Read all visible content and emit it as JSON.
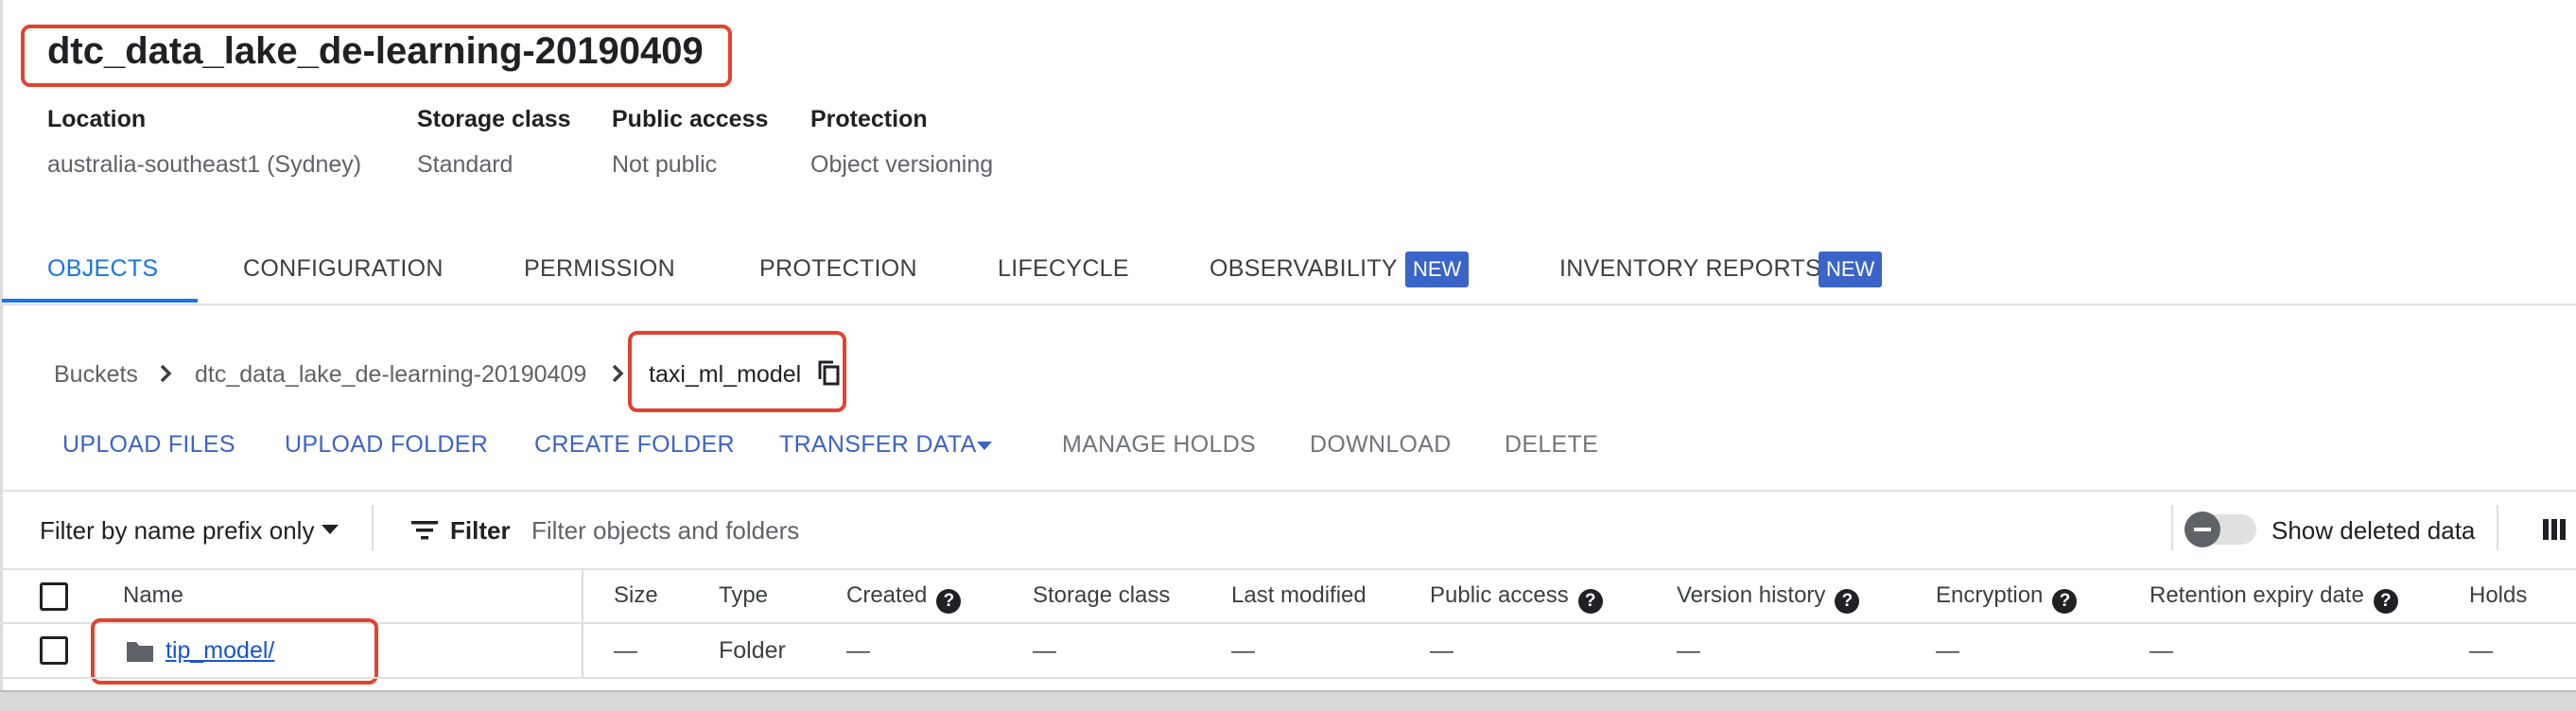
{
  "bucket": {
    "name": "dtc_data_lake_de-learning-20190409",
    "location_label": "Location",
    "location_value": "australia-southeast1 (Sydney)",
    "storage_class_label": "Storage class",
    "storage_class_value": "Standard",
    "public_access_label": "Public access",
    "public_access_value": "Not public",
    "protection_label": "Protection",
    "protection_value": "Object versioning"
  },
  "tabs": [
    {
      "label": "OBJECTS",
      "active": true
    },
    {
      "label": "CONFIGURATION"
    },
    {
      "label": "PERMISSION"
    },
    {
      "label": "PROTECTION"
    },
    {
      "label": "LIFECYCLE"
    },
    {
      "label": "OBSERVABILITY",
      "badge": "NEW"
    },
    {
      "label": "INVENTORY REPORTS",
      "badge": "NEW"
    }
  ],
  "breadcrumb": {
    "root": "Buckets",
    "bucket": "dtc_data_lake_de-learning-20190409",
    "current": "taxi_ml_model"
  },
  "actions": {
    "upload_files": "UPLOAD FILES",
    "upload_folder": "UPLOAD FOLDER",
    "create_folder": "CREATE FOLDER",
    "transfer_data": "TRANSFER DATA",
    "manage_holds": "MANAGE HOLDS",
    "download": "DOWNLOAD",
    "delete": "DELETE"
  },
  "filter": {
    "mode": "Filter by name prefix only",
    "label": "Filter",
    "placeholder": "Filter objects and folders",
    "show_deleted": "Show deleted data"
  },
  "table": {
    "headers": {
      "name": "Name",
      "size": "Size",
      "type": "Type",
      "created": "Created",
      "storage_class": "Storage class",
      "last_modified": "Last modified",
      "public_access": "Public access",
      "version_history": "Version history",
      "encryption": "Encryption",
      "retention": "Retention expiry date",
      "holds": "Holds"
    },
    "rows": [
      {
        "name": "tip_model/",
        "size": "—",
        "type": "Folder",
        "created": "—",
        "storage_class": "—",
        "last_modified": "—",
        "public_access": "—",
        "version_history": "—",
        "encryption": "—",
        "retention": "—",
        "holds": "—"
      }
    ]
  },
  "colors": {
    "accent": "#1a73e8",
    "badge": "#3b64c9",
    "highlight": "#e0432e"
  }
}
